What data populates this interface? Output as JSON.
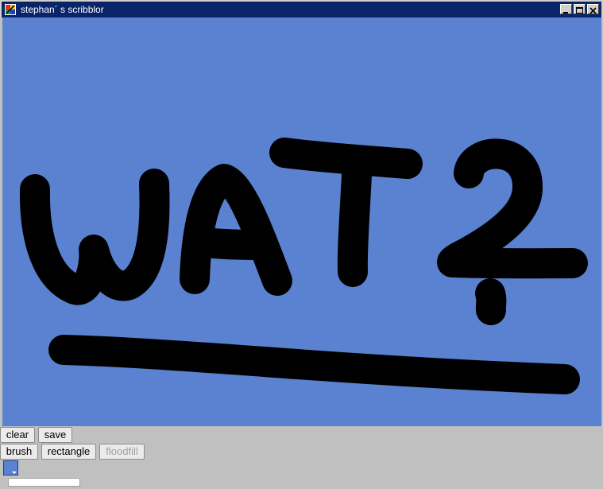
{
  "window": {
    "title": "stephan´ s scribblor",
    "controls": {
      "minimize": "minimize",
      "maximize": "maximize",
      "close": "close"
    }
  },
  "canvas": {
    "background_color": "#5a82d0",
    "stroke_color": "#000000",
    "drawing_text": "WAT?"
  },
  "toolbar": {
    "row1": [
      {
        "label": "clear",
        "enabled": true
      },
      {
        "label": "save",
        "enabled": true
      }
    ],
    "row2": [
      {
        "label": "brush",
        "enabled": true
      },
      {
        "label": "rectangle",
        "enabled": true
      },
      {
        "label": "floodfill",
        "enabled": false
      }
    ]
  },
  "color_picker": {
    "selected_color": "#5a82d0",
    "icon": "dropdown-arrow-icon"
  },
  "size_field": {
    "value": ""
  }
}
